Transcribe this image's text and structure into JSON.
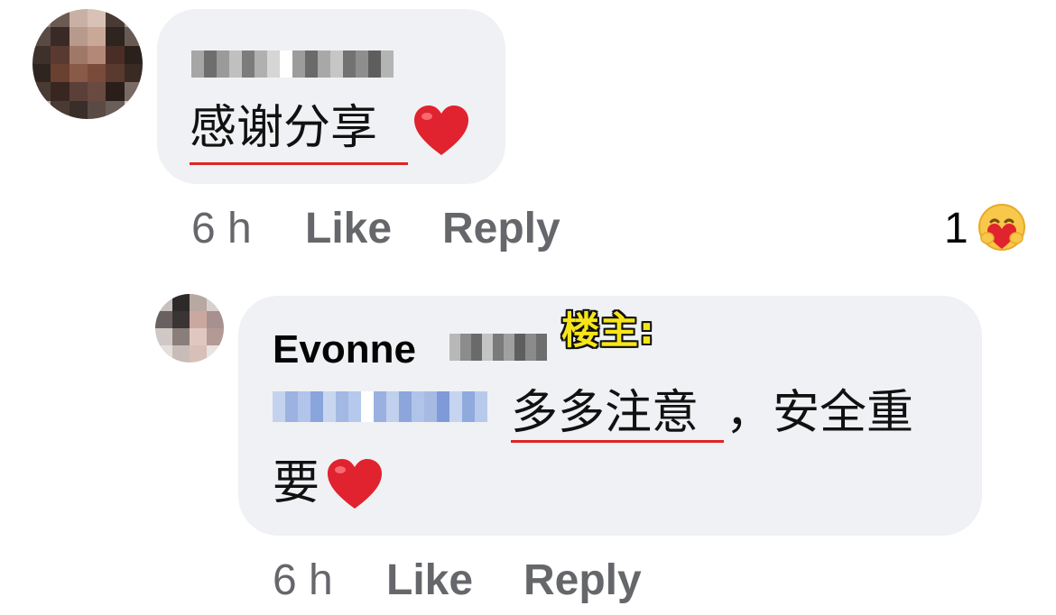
{
  "comment": {
    "text": "感谢分享",
    "time": "6 h",
    "like_label": "Like",
    "reply_label": "Reply",
    "reaction_count": "1",
    "reaction_icon": "care-emoji"
  },
  "reply": {
    "author": "Evonne",
    "op_tag": "楼主:",
    "text_part1": "多多注意",
    "text_part2": "，安全重",
    "text_part3": "要",
    "time": "6 h",
    "like_label": "Like",
    "reply_label": "Reply"
  },
  "colors": {
    "bubble": "#eff1f4",
    "meta_text": "#65676b",
    "underline": "#e02424",
    "heart": "#e0232e",
    "op_tag": "#f7e51a"
  }
}
